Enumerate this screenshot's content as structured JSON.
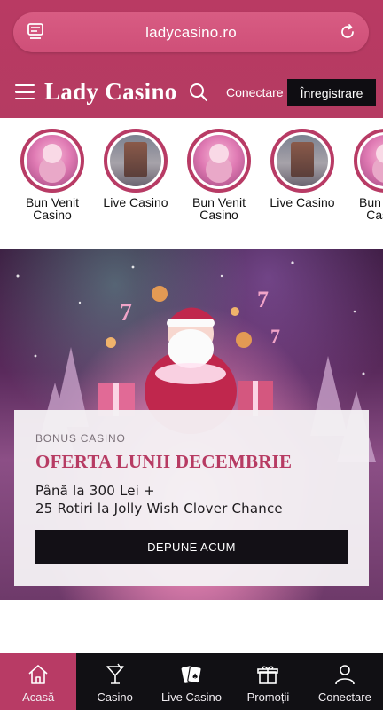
{
  "browser": {
    "url": "ladycasino.ro",
    "tabs_icon": "tabs-icon",
    "reload_icon": "reload-icon"
  },
  "header": {
    "menu_icon": "hamburger-menu-icon",
    "logo": "Lady Casino",
    "search_icon": "search-icon",
    "login_label": "Conectare",
    "register_label": "Înregistrare"
  },
  "stories": [
    {
      "label": "Bun Venit Casino",
      "image": "santa"
    },
    {
      "label": "Live Casino",
      "image": "live"
    },
    {
      "label": "Bun Venit Casino",
      "image": "santa"
    },
    {
      "label": "Live Casino",
      "image": "live"
    },
    {
      "label": "Bun Venit Casino",
      "image": "santa"
    }
  ],
  "promo": {
    "kicker": "BONUS CASINO",
    "title": "OFERTA LUNII DECEMBRIE",
    "line1": "Până la 300 Lei +",
    "line2": "25 Rotiri la Jolly Wish Clover Chance",
    "button": "DEPUNE ACUM"
  },
  "tabbar": [
    {
      "label": "Acasă",
      "icon": "home-icon",
      "active": true
    },
    {
      "label": "Casino",
      "icon": "cocktail-icon",
      "active": false
    },
    {
      "label": "Live Casino",
      "icon": "cards-icon",
      "active": false
    },
    {
      "label": "Promoții",
      "icon": "gift-icon",
      "active": false
    },
    {
      "label": "Conectare",
      "icon": "user-icon",
      "active": false
    }
  ],
  "colors": {
    "brand": "#b83b65",
    "dark": "#111014"
  }
}
